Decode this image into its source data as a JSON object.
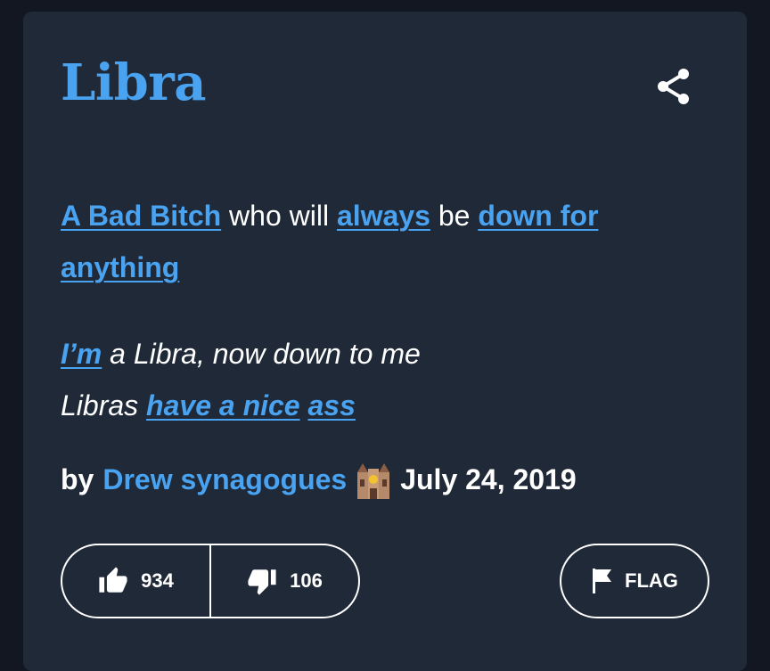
{
  "entry": {
    "word": "Libra",
    "meaning": {
      "p1": "A Bad Bitch",
      "p2": " who will ",
      "p3": "always",
      "p4": " be ",
      "p5": "down for anything"
    },
    "example": {
      "l1a": "I’m",
      "l1b": " a Libra, now down to me",
      "l2a": "Libras ",
      "l2b": "have a nice",
      "l2c": " ",
      "l2d": "ass"
    },
    "byline": {
      "by": "by",
      "author": "Drew synagogues",
      "date": "July 24, 2019"
    }
  },
  "actions": {
    "upvotes": "934",
    "downvotes": "106",
    "flag_label": "FLAG"
  },
  "colors": {
    "accent": "#4aa3f0",
    "card_bg": "#1f2937",
    "page_bg": "#131722"
  },
  "icons": [
    "share-icon",
    "synagogue-emoji",
    "thumbs-up-icon",
    "thumbs-down-icon",
    "flag-icon"
  ]
}
